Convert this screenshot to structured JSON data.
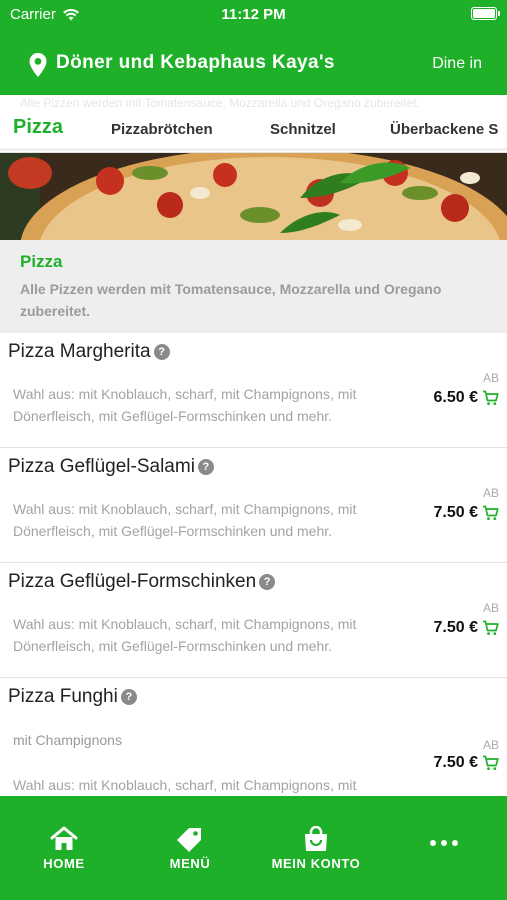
{
  "status_bar": {
    "carrier": "Carrier",
    "time": "11:12 PM"
  },
  "header": {
    "restaurant_name": "Döner und Kebaphaus Kaya's",
    "dine_in": "Dine in"
  },
  "tabs": [
    {
      "label": "Pizza",
      "active": true
    },
    {
      "label": "Pizzabrötchen",
      "active": false
    },
    {
      "label": "Schnitzel",
      "active": false
    },
    {
      "label": "Überbackene S",
      "active": false
    }
  ],
  "category": {
    "title": "Pizza",
    "description": "Alle Pizzen werden mit Tomatensauce, Mozzarella und Oregano zubereitet."
  },
  "items": [
    {
      "name": "Pizza Margherita",
      "extra": "",
      "description": "Wahl aus: mit Knoblauch, scharf, mit Champignons, mit Dönerfleisch, mit Geflügel-Formschinken und mehr.",
      "price_prefix": "AB",
      "price": "6.50 €"
    },
    {
      "name": "Pizza Geflügel-Salami",
      "extra": "",
      "description": "Wahl aus: mit Knoblauch, scharf, mit Champignons, mit Dönerfleisch, mit Geflügel-Formschinken und mehr.",
      "price_prefix": "AB",
      "price": "7.50 €"
    },
    {
      "name": "Pizza Geflügel-Formschinken",
      "extra": "",
      "description": "Wahl aus: mit Knoblauch, scharf, mit Champignons, mit Dönerfleisch, mit Geflügel-Formschinken und mehr.",
      "price_prefix": "AB",
      "price": "7.50 €"
    },
    {
      "name": "Pizza Funghi",
      "extra": "mit Champignons",
      "description": "Wahl aus: mit Knoblauch, scharf, mit Champignons, mit Dönerfleisch, mit Geflügel-Formschinken und mehr.",
      "price_prefix": "AB",
      "price": "7.50 €"
    }
  ],
  "bottom_nav": {
    "home": "HOME",
    "menu": "MENÜ",
    "account": "MEIN KONTO",
    "more_icon": "more-dots-icon"
  },
  "colors": {
    "brand_green": "#1fb02a",
    "category_bg": "#eeeeee"
  }
}
